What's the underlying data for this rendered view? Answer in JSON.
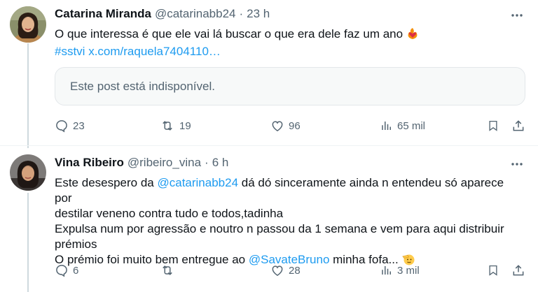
{
  "posts": [
    {
      "author_name": "Catarina Miranda",
      "handle": "@catarinabb24",
      "time": "23 h",
      "line1": "O que interessa é que ele vai lá buscar o que era dele faz um ano",
      "hashtag": "#sstvi",
      "url": "x.com/raquela7404110…",
      "quote_unavailable": "Este post está indisponível.",
      "replies": "23",
      "reposts": "19",
      "likes": "96",
      "views": "65 mil"
    },
    {
      "author_name": "Vina Ribeiro",
      "handle": "@ribeiro_vina",
      "time": "6 h",
      "line1_prefix": "Este desespero da ",
      "line1_mention": "@catarinabb24",
      "line1_suffix": " dá dó sinceramente ainda n entendeu só aparece por",
      "line2": "destilar veneno contra tudo e todos,tadinha",
      "line3": "Expulsa num por agressão e noutro n passou da 1 semana e vem para aqui distribuir",
      "line4": "prémios",
      "line5_prefix": "O prémio foi muito bem entregue ao ",
      "line5_mention": "@SavateBruno",
      "line5_suffix": " minha fofa... ",
      "replies": "6",
      "reposts": "",
      "likes": "28",
      "views": "3 mil"
    }
  ],
  "icons": {
    "reply": "reply-icon",
    "repost": "repost-icon",
    "like": "like-icon",
    "views": "views-icon",
    "bookmark": "bookmark-icon",
    "share": "share-icon",
    "more": "more-icon"
  },
  "colors": {
    "link": "#1d9bf0",
    "secondary_text": "#536471",
    "thread_line": "#cfd9de"
  }
}
